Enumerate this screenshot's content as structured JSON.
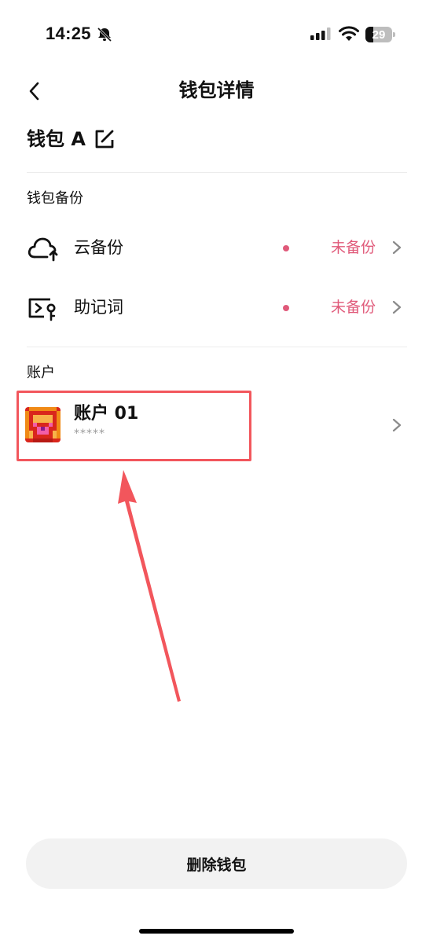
{
  "status_bar": {
    "time": "14:25",
    "battery_level": "29",
    "icons": [
      "bell-slash-icon",
      "cellular-signal-icon",
      "wifi-icon",
      "battery-icon"
    ]
  },
  "nav": {
    "title": "钱包详情",
    "back_icon": "chevron-left-icon"
  },
  "wallet": {
    "name": "钱包 A",
    "edit_icon": "edit-icon"
  },
  "backup_section": {
    "title": "钱包备份",
    "items": [
      {
        "label": "云备份",
        "status": "未备份",
        "icon": "cloud-upload-icon"
      },
      {
        "label": "助记词",
        "status": "未备份",
        "icon": "mnemonic-key-icon"
      }
    ]
  },
  "account_section": {
    "title": "账户",
    "accounts": [
      {
        "name": "账户 01",
        "balance_masked": "*****",
        "icon": "pixel-avatar-icon"
      }
    ]
  },
  "actions": {
    "delete_label": "删除钱包"
  },
  "colors": {
    "accent_status": "#e05a7a",
    "highlight_box": "#f2565c",
    "button_bg": "#f2f2f2"
  }
}
